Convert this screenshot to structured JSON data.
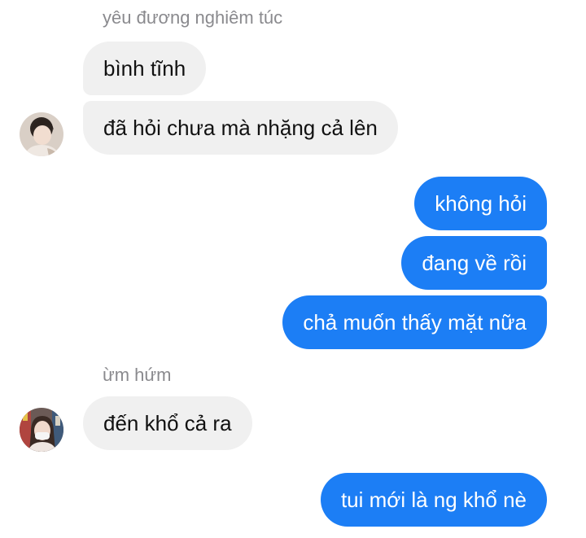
{
  "conversation": {
    "group_1": {
      "sender_name": "yêu đương nghiêm túc",
      "messages": [
        "bình tĩnh",
        "đã hỏi chưa mà nhặng cả lên"
      ],
      "avatar": "contact-photo-avatar"
    },
    "outgoing_1": {
      "messages": [
        "không hỏi",
        "đang về rồi",
        "chả muốn thấy mặt nữa"
      ]
    },
    "group_2": {
      "sender_name": "ừm hứm",
      "messages": [
        "đến khổ cả ra"
      ],
      "avatar": "contact-photo-avatar"
    },
    "outgoing_2": {
      "messages": [
        "tui mới là ng khổ nè"
      ]
    }
  },
  "colors": {
    "incoming_bubble": "#f0f0f0",
    "outgoing_bubble": "#1c7ef5",
    "sender_name_text": "#8a8a8e",
    "incoming_text": "#111111",
    "outgoing_text": "#ffffff"
  }
}
